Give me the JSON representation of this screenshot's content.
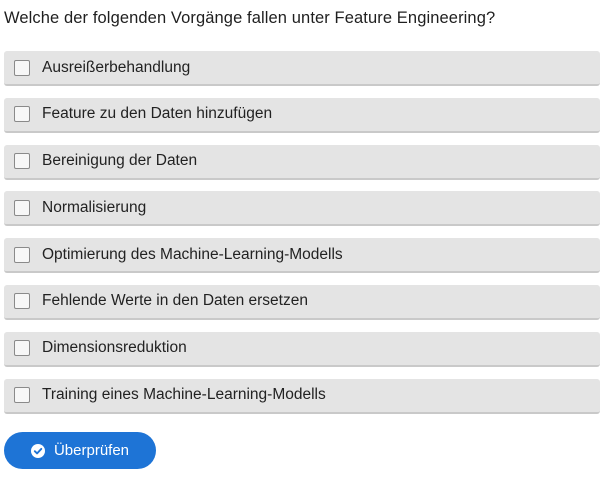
{
  "question": "Welche der folgenden Vorgänge fallen unter Feature Engineering?",
  "options": [
    {
      "label": "Ausreißerbehandlung",
      "checked": false
    },
    {
      "label": "Feature zu den Daten hinzufügen",
      "checked": false
    },
    {
      "label": "Bereinigung der Daten",
      "checked": false
    },
    {
      "label": "Normalisierung",
      "checked": false
    },
    {
      "label": "Optimierung des Machine-Learning-Modells",
      "checked": false
    },
    {
      "label": "Fehlende Werte in den Daten ersetzen",
      "checked": false
    },
    {
      "label": "Dimensionsreduktion",
      "checked": false
    },
    {
      "label": "Training eines Machine-Learning-Modells",
      "checked": false
    }
  ],
  "submit": {
    "label": "Überprüfen",
    "icon": "check-circle-icon"
  },
  "colors": {
    "accent": "#1e74d6",
    "option_background": "#e4e4e4"
  }
}
